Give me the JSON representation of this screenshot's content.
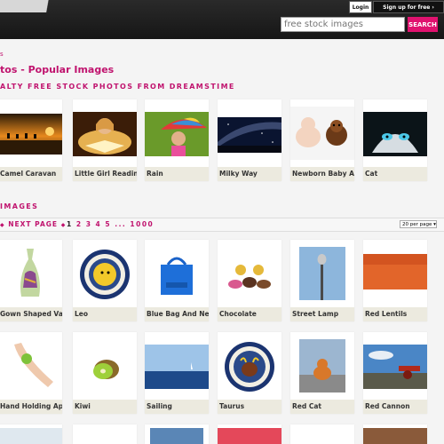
{
  "header": {
    "login_label": "Login",
    "signup_label": "Sign up for free",
    "search_placeholder": "free stock images",
    "search_button": "SEARCH"
  },
  "breadcrumb": "s",
  "page_title": "tos - Popular Images",
  "subtitle": "ALTY FREE STOCK PHOTOS FROM DREAMSTIME",
  "popular": [
    {
      "caption": "Camel Caravan"
    },
    {
      "caption": "Little Girl Reading"
    },
    {
      "caption": "Rain"
    },
    {
      "caption": "Milky Way"
    },
    {
      "caption": "Newborn Baby An"
    },
    {
      "caption": "Cat"
    }
  ],
  "images_section_title": "IMAGES",
  "pager": {
    "next_label": "NEXT PAGE",
    "current": "1",
    "pages": [
      "2",
      "3",
      "4",
      "5"
    ],
    "ellipsis": "...",
    "last": "1000",
    "per_page": "20 per page"
  },
  "grid_row1": [
    {
      "caption": "Gown Shaped Vas"
    },
    {
      "caption": "Leo"
    },
    {
      "caption": "Blue Bag And Nec"
    },
    {
      "caption": "Chocolate"
    },
    {
      "caption": "Street Lamp"
    },
    {
      "caption": "Red Lentils"
    }
  ],
  "grid_row2": [
    {
      "caption": "Hand Holding App"
    },
    {
      "caption": "Kiwi"
    },
    {
      "caption": "Sailing"
    },
    {
      "caption": "Taurus"
    },
    {
      "caption": "Red Cat"
    },
    {
      "caption": "Red Cannon"
    }
  ],
  "colors": {
    "accent": "#c0136e",
    "search_button": "#e0126f",
    "caption_bg": "#eceadf"
  }
}
